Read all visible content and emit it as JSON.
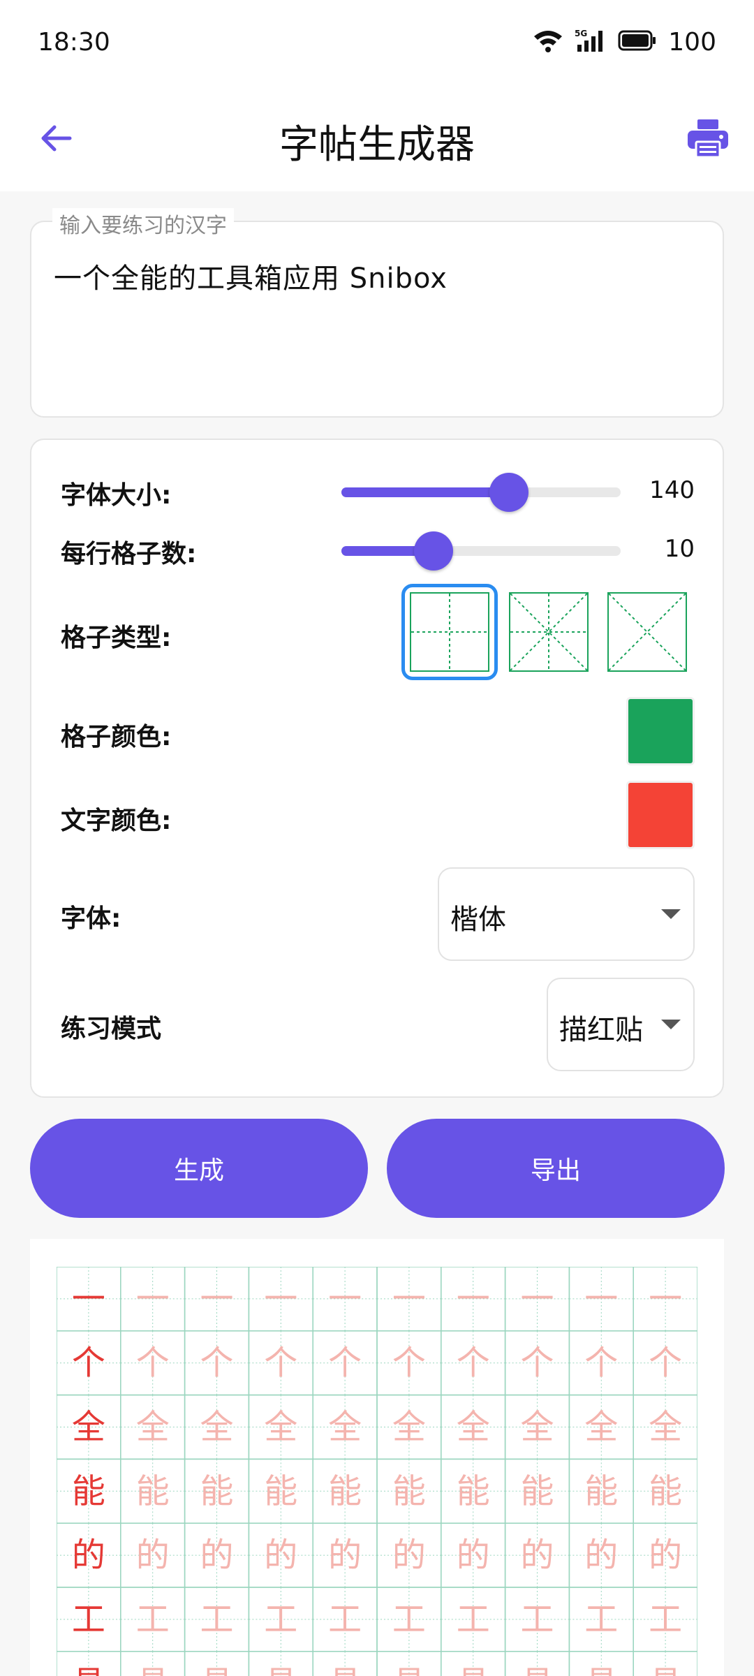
{
  "status_bar": {
    "time": "18:30",
    "network": "5G",
    "battery": "100"
  },
  "app_bar": {
    "title": "字帖生成器",
    "back_icon": "arrow-left-icon",
    "print_icon": "printer-icon"
  },
  "input": {
    "label": "输入要练习的汉字",
    "value": "一个全能的工具箱应用 Snibox"
  },
  "settings": {
    "font_size_label": "字体大小:",
    "font_size_value": "140",
    "font_size_fraction": 0.6,
    "per_row_label": "每行格子数:",
    "per_row_value": "10",
    "per_row_fraction": 0.33,
    "grid_type_label": "格子类型:",
    "grid_types": [
      "tian-grid",
      "mi-grid",
      "cross-grid"
    ],
    "grid_type_selected": 0,
    "grid_color_label": "格子颜色:",
    "grid_color": "#1aa35b",
    "text_color_label": "文字颜色:",
    "text_color": "#f44336",
    "font_label": "字体:",
    "font_value": "楷体",
    "mode_label": "练习模式",
    "mode_value": "描红贴"
  },
  "actions": {
    "generate_label": "生成",
    "export_label": "导出"
  },
  "sheet": {
    "chars": [
      "一",
      "个",
      "全",
      "能",
      "的",
      "工",
      "具"
    ],
    "columns": 10,
    "model_color": "#e53935",
    "trace_color": "#f4b4ae",
    "line_color": "#9bd6bf"
  },
  "colors": {
    "accent": "#6753e6",
    "selection": "#2a8cf0"
  }
}
